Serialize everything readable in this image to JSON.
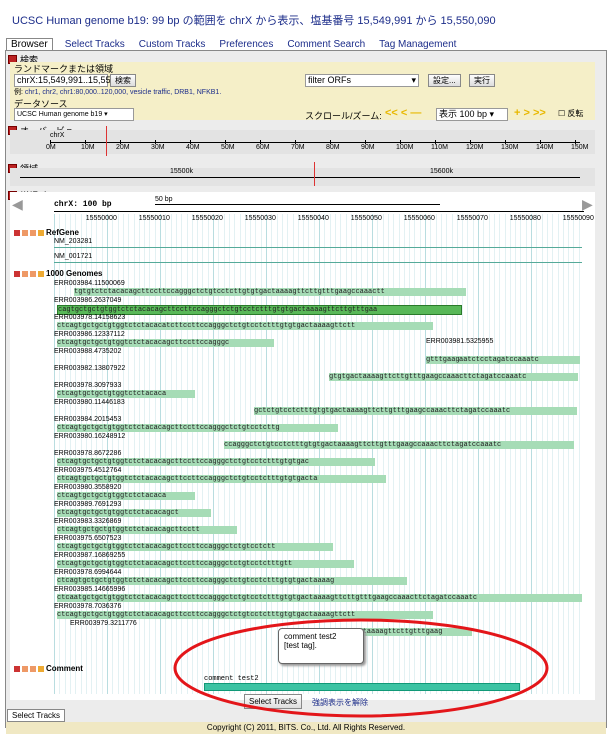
{
  "title": "UCSC Human genome b19: 99 bp の範囲を chrX から表示、塩基番号 15,549,991 から 15,550,090",
  "tabs": [
    "Browser",
    "Select Tracks",
    "Custom Tracks",
    "Preferences",
    "Comment Search",
    "Tag Management"
  ],
  "search": {
    "section_label": "検索",
    "landmark_label": "ランドマークまたは領域",
    "landmark_value": "chrX:15,549,991..15,550",
    "search_button": "検索",
    "examples_prefix": "例:",
    "examples": "chr1, chr2, chr1:80,000..120,000, vesicle traffic, DRB1, NFKB1.",
    "datasource_label": "データソース",
    "datasource_value": "UCSC Human genome b19",
    "filter_value": "filter ORFs",
    "settings_button": "設定...",
    "run_button": "実行",
    "scroll_label": "スクロール/ズーム:",
    "display_value": "表示 100 bp",
    "flip_label": "反転"
  },
  "overview": {
    "label": "オーバービュー",
    "chrom": "chrX",
    "ticks": [
      "0M",
      "10M",
      "20M",
      "30M",
      "40M",
      "50M",
      "60M",
      "70M",
      "80M",
      "90M",
      "100M",
      "110M",
      "120M",
      "130M",
      "140M",
      "150M"
    ]
  },
  "region": {
    "label": "領域",
    "ticks": [
      "15500k",
      "15600k"
    ]
  },
  "detail": {
    "label": "詳細ビュー",
    "chrom_label": "chrX: 100 bp",
    "scale_label": "50 bp",
    "ruler": [
      "15550000",
      "15550010",
      "15550020",
      "15550030",
      "15550040",
      "15550050",
      "15550060",
      "15550070",
      "15550080",
      "15550090"
    ],
    "refgene": {
      "name": "RefGene",
      "rows": [
        "NM_203281",
        "NM_001721"
      ]
    },
    "genomes": {
      "name": "1000 Genomes",
      "rows": [
        {
          "id": "ERR003984.11500069",
          "seq": "tgtgtctctacacagcttccttccagggctctgtcctcttgtgtgactaaaagttcttgtttgaagccaaactt"
        },
        {
          "id": "ERR003986.2637049",
          "seq": "cagtgctgctgtggtctctacacagcttccttccagggctctgtcctctttgtgtgactaaaagttcttgtttgaa"
        },
        {
          "id": "ERR003978.14158623",
          "seq": "ctcagtgctgctgtggtctctacacatcttccttccagggctctgtcctctttgtgtgactaaaagttctt"
        },
        {
          "id": "ERR003986.12337112",
          "seq": "ctcagtgctgctgtggtctctacacagcttccttccagggc"
        },
        {
          "id": "ERR003981.5325955",
          "seq": "gtttgaagccaaacttctagatccaaatc"
        },
        {
          "id": "ERR003988.4735202",
          "seq": "aatctcctagatccaaatc"
        },
        {
          "id": "ERR003982.13807922",
          "seq": "gtgtgactaaaagttcttgtttgaagccaaacttctagatccaaatc"
        },
        {
          "id": "ERR003978.3097933",
          "seq": "ctcagtgctgctgtggtctctacaca"
        },
        {
          "id": "ERR003980.11446183",
          "seq": "gctctgtcctctttgtgtgactaaaagttcttgtttgaagccaaacttctagatccaaatc"
        },
        {
          "id": "ERR003984.2015453",
          "seq": "ctcagtgctgctgtggtctctacacagcttccttccagggctctgtcctcttg"
        },
        {
          "id": "ERR003980.16248912",
          "seq": "ccagggctctgtcctctttgtgtgactaaaagttcttgtttgaagccaaacttctagatccaaatc"
        },
        {
          "id": "ERR003978.8672286",
          "seq": "ctcagtgctgctgtggtctctacacagcttccttccagggctctgtcctctttgtgtgac"
        },
        {
          "id": "ERR003975.4512764",
          "seq": "ctcagtgctgctgtggtctctacacagcttccttccagggctctgtcctctttgtgtgacta"
        },
        {
          "id": "ERR003980.3558920",
          "seq": "ctcagtgctgctgtggtctctacaca"
        },
        {
          "id": "ERR003989.7691293",
          "seq": "ctcagtgctgctgtggtctctacacagct"
        },
        {
          "id": "ERR003983.3326869",
          "seq": "ctcagtgctgctgtggtctctacacagcttcctt"
        },
        {
          "id": "ERR003975.6507523",
          "seq": "ctcagtgctgctgtggtctctacacagcttccttccagggctctgtcctctt"
        },
        {
          "id": "ERR003987.16869255",
          "seq": "ctcagtgctgctgtggtctctacacagcttccttccagggctctgtcctctttgtt"
        },
        {
          "id": "ERR003978.6994644",
          "seq": "ctcagtgctgctgtggtctctacacagcttccttccagggctctgtcctctttgtgtgactaaaag"
        },
        {
          "id": "ERR003985.14665996",
          "seq": "ctcaatgctgctgtggtctctacacagcttccttccagggctctgtcctctttgtgtgactaaaagttcttgtttgaagccaaacttctagatccaaatc"
        },
        {
          "id": "ERR003978.7036376",
          "seq": "ctcagtgctgctgtggtctctacacagcttccttccagggctctgtcctctttgtgtgactaaaagttctt"
        },
        {
          "id": "ERR003979.3211776",
          "seq": "tgtgtgactaaaagttcttgtttgaag"
        }
      ],
      "extra_seq": "tctagatccaaatc"
    },
    "comment_track": {
      "name": "Comment",
      "label": "comment test2"
    }
  },
  "tooltip": {
    "line1": "comment test2",
    "line2": "[test tag]."
  },
  "buttons": {
    "select_tracks": "Select Tracks",
    "emphasis_off": "強調表示を解除"
  },
  "bottom_tab": "Select Tracks",
  "footer": "Copyright (C) 2011, BITS. Co., Ltd. All Rights Reserved.",
  "colors": {
    "seq_bar": "#a6dcb6",
    "highlight": "#58b858",
    "ellipse": "#e3161a",
    "comment_bar": "#3cc3a3"
  }
}
